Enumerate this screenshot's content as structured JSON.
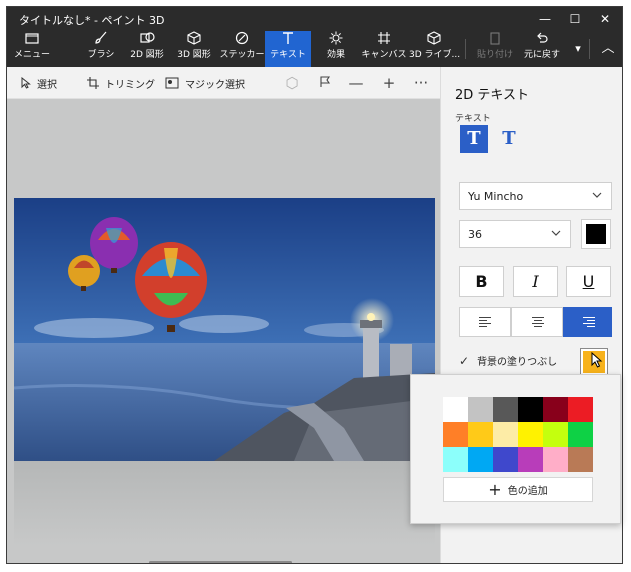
{
  "window": {
    "title": "タイトルなし* - ペイント 3D"
  },
  "window_controls": {
    "minimize": "—",
    "maximize": "☐",
    "close": "✕"
  },
  "ribbon": {
    "items": [
      {
        "label": "メニュー",
        "icon": "folder-icon"
      },
      {
        "label": "ブラシ",
        "icon": "brush-icon"
      },
      {
        "label": "2D 図形",
        "icon": "2d-shapes-icon"
      },
      {
        "label": "3D 図形",
        "icon": "3d-shapes-icon"
      },
      {
        "label": "ステッカー",
        "icon": "sticker-icon"
      },
      {
        "label": "テキスト",
        "icon": "text-icon"
      },
      {
        "label": "効果",
        "icon": "effects-icon"
      },
      {
        "label": "キャンバス",
        "icon": "canvas-icon"
      },
      {
        "label": "3D ライブ...",
        "icon": "3d-library-icon"
      },
      {
        "label": "貼り付け",
        "icon": "paste-icon"
      },
      {
        "label": "元に戻す",
        "icon": "undo-icon"
      }
    ],
    "active": "テキスト",
    "more_glyph": "▾",
    "collapse_glyph": "︿"
  },
  "toolbar": {
    "select": "選択",
    "crop": "トリミング",
    "magic_select": "マジック選択",
    "minus": "—",
    "plus": "+",
    "more": "···"
  },
  "panel": {
    "title": "2D テキスト",
    "text_section": "テキスト",
    "text_type_plain": "T",
    "text_type_3d": "T",
    "font": "Yu Mincho",
    "size": "36",
    "text_color": "#000000",
    "bold": "B",
    "italic": "I",
    "underline": "U",
    "alignment": "right",
    "background_fill_label": "背景の塗りつぶし",
    "background_fill_checked": true,
    "background_fill_checkmark": "✓",
    "background_fill_color": "#f7b21b"
  },
  "color_picker": {
    "palette": [
      "#ffffff",
      "#c3c3c3",
      "#585858",
      "#000000",
      "#88001b",
      "#ec1c24",
      "#ff7f27",
      "#ffca18",
      "#fdeca6",
      "#fff200",
      "#c4ff0e",
      "#0ed145",
      "#8cfffb",
      "#00a8f3",
      "#3f48cc",
      "#b83dba",
      "#ffaec8",
      "#b97a56"
    ],
    "add_color_label": "色の追加",
    "add_color_glyph": "+"
  }
}
